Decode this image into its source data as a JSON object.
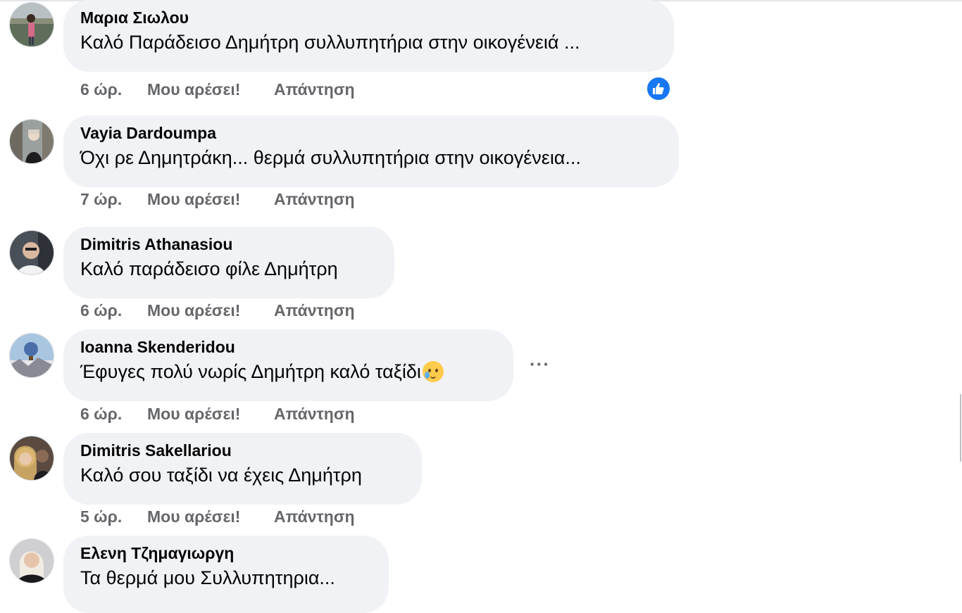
{
  "comments": [
    {
      "author": "Μαρια Σιωλου",
      "text": "Καλό Παράδεισο Δημήτρη συλλυπητήρια στην οικογένειά ...",
      "time": "6 ώρ.",
      "like_label": "Μου αρέσει!",
      "reply_label": "Απάντηση",
      "reaction": "like-icon"
    },
    {
      "author": "Vayia Dardoumpa",
      "text": "Όχι ρε Δημητράκη... θερμά συλλυπητήρια στην οικογένεια...",
      "time": "7 ώρ.",
      "like_label": "Μου αρέσει!",
      "reply_label": "Απάντηση"
    },
    {
      "author": "Dimitris Athanasiou",
      "text": "Καλό παράδεισο φίλε Δημήτρη",
      "time": "6 ώρ.",
      "like_label": "Μου αρέσει!",
      "reply_label": "Απάντηση"
    },
    {
      "author": "Ioanna Skenderidou",
      "text": "Έφυγες πολύ νωρίς Δημήτρη καλό ταξίδι",
      "emoji": "smiling-face-with-tear",
      "time": "6 ώρ.",
      "like_label": "Μου αρέσει!",
      "reply_label": "Απάντηση",
      "more_label": "···"
    },
    {
      "author": "Dimitris Sakellariou",
      "text": "Καλό σου ταξίδι να έχεις Δημήτρη",
      "time": "5 ώρ.",
      "like_label": "Μου αρέσει!",
      "reply_label": "Απάντηση"
    },
    {
      "author": "Ελενη Τζημαγιωργη",
      "text": "Τα θερμά μου Συλλυπητηρια..."
    }
  ],
  "colors": {
    "bubble": "#f0f2f5",
    "like_blue": "#1877f2",
    "meta_gray": "#65676b",
    "text": "#050505"
  }
}
